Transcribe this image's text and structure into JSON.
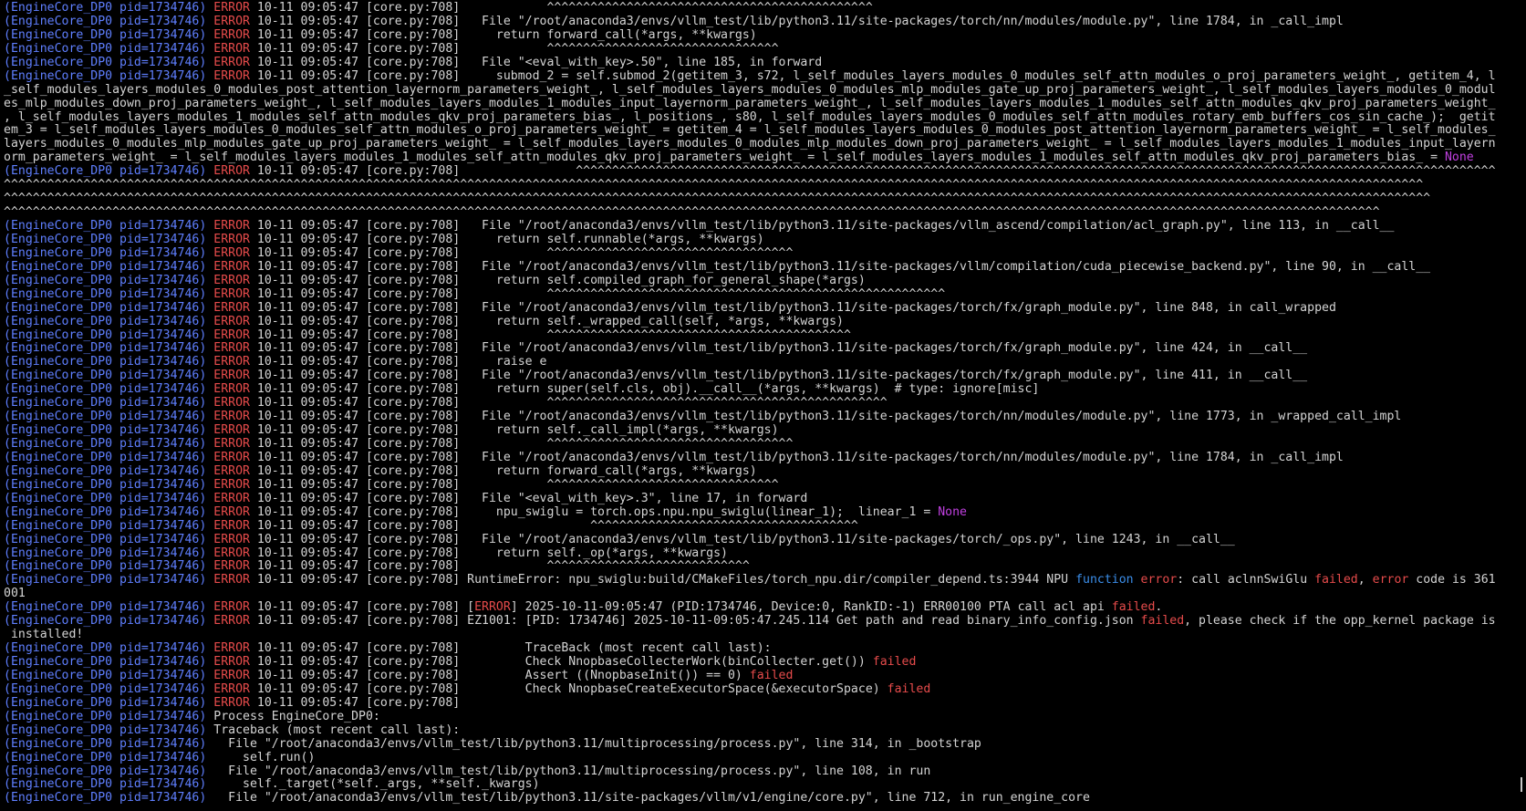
{
  "lines": [
    {
      "seg": [
        {
          "t": "(EngineCore_DP0 pid=1734746) ",
          "c": "proc"
        },
        {
          "t": "ERROR",
          "c": "lvl"
        },
        {
          "t": " 10-11 09:05:47 [core.py:708]            ^^^^^^^^^^^^^^^^^^^^^^^^^^^^^^^^^^^^^^^^^^^^^"
        }
      ]
    },
    {
      "seg": [
        {
          "t": "(EngineCore_DP0 pid=1734746) ",
          "c": "proc"
        },
        {
          "t": "ERROR",
          "c": "lvl"
        },
        {
          "t": " 10-11 09:05:47 [core.py:708]   File \"/root/anaconda3/envs/vllm_test/lib/python3.11/site-packages/torch/nn/modules/module.py\", line 1784, in _call_impl"
        }
      ]
    },
    {
      "seg": [
        {
          "t": "(EngineCore_DP0 pid=1734746) ",
          "c": "proc"
        },
        {
          "t": "ERROR",
          "c": "lvl"
        },
        {
          "t": " 10-11 09:05:47 [core.py:708]     return forward_call(*args, **kwargs)"
        }
      ]
    },
    {
      "seg": [
        {
          "t": "(EngineCore_DP0 pid=1734746) ",
          "c": "proc"
        },
        {
          "t": "ERROR",
          "c": "lvl"
        },
        {
          "t": " 10-11 09:05:47 [core.py:708]            ^^^^^^^^^^^^^^^^^^^^^^^^^^^^^^^^"
        }
      ]
    },
    {
      "seg": [
        {
          "t": "(EngineCore_DP0 pid=1734746) ",
          "c": "proc"
        },
        {
          "t": "ERROR",
          "c": "lvl"
        },
        {
          "t": " 10-11 09:05:47 [core.py:708]   File \"<eval_with_key>.50\", line 185, in forward"
        }
      ]
    },
    {
      "seg": [
        {
          "t": "(EngineCore_DP0 pid=1734746) ",
          "c": "proc"
        },
        {
          "t": "ERROR",
          "c": "lvl"
        },
        {
          "t": " 10-11 09:05:47 [core.py:708]     submod_2 = self.submod_2(getitem_3, s72, l_self_modules_layers_modules_0_modules_self_attn_modules_o_proj_parameters_weight_, getitem_4, l"
        }
      ]
    },
    {
      "seg": [
        {
          "t": "_self_modules_layers_modules_0_modules_post_attention_layernorm_parameters_weight_, l_self_modules_layers_modules_0_modules_mlp_modules_gate_up_proj_parameters_weight_, l_self_modules_layers_modules_0_modul"
        }
      ]
    },
    {
      "seg": [
        {
          "t": "es_mlp_modules_down_proj_parameters_weight_, l_self_modules_layers_modules_1_modules_input_layernorm_parameters_weight_, l_self_modules_layers_modules_1_modules_self_attn_modules_qkv_proj_parameters_weight_"
        }
      ]
    },
    {
      "seg": [
        {
          "t": ", l_self_modules_layers_modules_1_modules_self_attn_modules_qkv_proj_parameters_bias_, l_positions_, s80, l_self_modules_layers_modules_0_modules_self_attn_modules_rotary_emb_buffers_cos_sin_cache_);  getit"
        }
      ]
    },
    {
      "seg": [
        {
          "t": "em_3 = l_self_modules_layers_modules_0_modules_self_attn_modules_o_proj_parameters_weight_ = getitem_4 = l_self_modules_layers_modules_0_modules_post_attention_layernorm_parameters_weight_ = l_self_modules_"
        }
      ]
    },
    {
      "seg": [
        {
          "t": "layers_modules_0_modules_mlp_modules_gate_up_proj_parameters_weight_ = l_self_modules_layers_modules_0_modules_mlp_modules_down_proj_parameters_weight_ = l_self_modules_layers_modules_1_modules_input_layern"
        }
      ]
    },
    {
      "seg": [
        {
          "t": "orm_parameters_weight_ = l_self_modules_layers_modules_1_modules_self_attn_modules_qkv_proj_parameters_weight_ = l_self_modules_layers_modules_1_modules_self_attn_modules_qkv_proj_parameters_bias_ = "
        },
        {
          "t": "None",
          "c": "none"
        }
      ]
    },
    {
      "seg": [
        {
          "t": "(EngineCore_DP0 pid=1734746) ",
          "c": "proc"
        },
        {
          "t": "ERROR",
          "c": "lvl"
        },
        {
          "t": " 10-11 09:05:47 [core.py:708]                ^^^^^^^^^^^^^^^^^^^^^^^^^^^^^^^^^^^^^^^^^^^^^^^^^^^^^^^^^^^^^^^^^^^^^^^^^^^^^^^^^^^^^^^^^^^^^^^^^^^^^^^^^^^^^^^^^^^^^^^^^^^^^^^"
        }
      ]
    },
    {
      "seg": [
        {
          "t": "^^^^^^^^^^^^^^^^^^^^^^^^^^^^^^^^^^^^^^^^^^^^^^^^^^^^^^^^^^^^^^^^^^^^^^^^^^^^^^^^^^^^^^^^^^^^^^^^^^^^^^^^^^^^^^^^^^^^^^^^^^^^^^^^^^^^^^^^^^^^^^^^^^^^^^^^^^^^^^^^^^^^^^^^^^^^^^^^^^^^^^^^^^^^^^^^^^^^"
        }
      ]
    },
    {
      "seg": [
        {
          "t": "^^^^^^^^^^^^^^^^^^^^^^^^^^^^^^^^^^^^^^^^^^^^^^^^^^^^^^^^^^^^^^^^^^^^^^^^^^^^^^^^^^^^^^^^^^^^^^^^^^^^^^^^^^^^^^^^^^^^^^^^^^^^^^^^^^^^^^^^^^^^^^^^^^^^^^^^^^^^^^^^^^^^^^^^^^^^^^^^^^^^^^^^^^^^^^^^^^^^^"
        }
      ]
    },
    {
      "seg": [
        {
          "t": "^^^^^^^^^^^^^^^^^^^^^^^^^^^^^^^^^^^^^^^^^^^^^^^^^^^^^^^^^^^^^^^^^^^^^^^^^^^^^^^^^^^^^^^^^^^^^^^^^^^^^^^^^^^^^^^^^^^^^^^^^^^^^^^^^^^^^^^^^^^^^^^^^^^^^^^^^^^^^^^^^^^^^^^^^^^^^^^^^^^^^^^^^^^^^^"
        }
      ]
    },
    {
      "seg": [
        {
          "t": "(EngineCore_DP0 pid=1734746) ",
          "c": "proc"
        },
        {
          "t": "ERROR",
          "c": "lvl"
        },
        {
          "t": " 10-11 09:05:47 [core.py:708]   File \"/root/anaconda3/envs/vllm_test/lib/python3.11/site-packages/vllm_ascend/compilation/acl_graph.py\", line 113, in __call__"
        }
      ]
    },
    {
      "seg": [
        {
          "t": "(EngineCore_DP0 pid=1734746) ",
          "c": "proc"
        },
        {
          "t": "ERROR",
          "c": "lvl"
        },
        {
          "t": " 10-11 09:05:47 [core.py:708]     return self.runnable(*args, **kwargs)"
        }
      ]
    },
    {
      "seg": [
        {
          "t": "(EngineCore_DP0 pid=1734746) ",
          "c": "proc"
        },
        {
          "t": "ERROR",
          "c": "lvl"
        },
        {
          "t": " 10-11 09:05:47 [core.py:708]            ^^^^^^^^^^^^^^^^^^^^^^^^^^^^^^^^^^"
        }
      ]
    },
    {
      "seg": [
        {
          "t": "(EngineCore_DP0 pid=1734746) ",
          "c": "proc"
        },
        {
          "t": "ERROR",
          "c": "lvl"
        },
        {
          "t": " 10-11 09:05:47 [core.py:708]   File \"/root/anaconda3/envs/vllm_test/lib/python3.11/site-packages/vllm/compilation/cuda_piecewise_backend.py\", line 90, in __call__"
        }
      ]
    },
    {
      "seg": [
        {
          "t": "(EngineCore_DP0 pid=1734746) ",
          "c": "proc"
        },
        {
          "t": "ERROR",
          "c": "lvl"
        },
        {
          "t": " 10-11 09:05:47 [core.py:708]     return self.compiled_graph_for_general_shape(*args)"
        }
      ]
    },
    {
      "seg": [
        {
          "t": "(EngineCore_DP0 pid=1734746) ",
          "c": "proc"
        },
        {
          "t": "ERROR",
          "c": "lvl"
        },
        {
          "t": " 10-11 09:05:47 [core.py:708]            ^^^^^^^^^^^^^^^^^^^^^^^^^^^^^^^^^^^^^^^^^^^^^^^^^^^^^^^"
        }
      ]
    },
    {
      "seg": [
        {
          "t": "(EngineCore_DP0 pid=1734746) ",
          "c": "proc"
        },
        {
          "t": "ERROR",
          "c": "lvl"
        },
        {
          "t": " 10-11 09:05:47 [core.py:708]   File \"/root/anaconda3/envs/vllm_test/lib/python3.11/site-packages/torch/fx/graph_module.py\", line 848, in call_wrapped"
        }
      ]
    },
    {
      "seg": [
        {
          "t": "(EngineCore_DP0 pid=1734746) ",
          "c": "proc"
        },
        {
          "t": "ERROR",
          "c": "lvl"
        },
        {
          "t": " 10-11 09:05:47 [core.py:708]     return self._wrapped_call(self, *args, **kwargs)"
        }
      ]
    },
    {
      "seg": [
        {
          "t": "(EngineCore_DP0 pid=1734746) ",
          "c": "proc"
        },
        {
          "t": "ERROR",
          "c": "lvl"
        },
        {
          "t": " 10-11 09:05:47 [core.py:708]            ^^^^^^^^^^^^^^^^^^^^^^^^^^^^^^^^^^^^^^^^^^"
        }
      ]
    },
    {
      "seg": [
        {
          "t": "(EngineCore_DP0 pid=1734746) ",
          "c": "proc"
        },
        {
          "t": "ERROR",
          "c": "lvl"
        },
        {
          "t": " 10-11 09:05:47 [core.py:708]   File \"/root/anaconda3/envs/vllm_test/lib/python3.11/site-packages/torch/fx/graph_module.py\", line 424, in __call__"
        }
      ]
    },
    {
      "seg": [
        {
          "t": "(EngineCore_DP0 pid=1734746) ",
          "c": "proc"
        },
        {
          "t": "ERROR",
          "c": "lvl"
        },
        {
          "t": " 10-11 09:05:47 [core.py:708]     raise e"
        }
      ]
    },
    {
      "seg": [
        {
          "t": "(EngineCore_DP0 pid=1734746) ",
          "c": "proc"
        },
        {
          "t": "ERROR",
          "c": "lvl"
        },
        {
          "t": " 10-11 09:05:47 [core.py:708]   File \"/root/anaconda3/envs/vllm_test/lib/python3.11/site-packages/torch/fx/graph_module.py\", line 411, in __call__"
        }
      ]
    },
    {
      "seg": [
        {
          "t": "(EngineCore_DP0 pid=1734746) ",
          "c": "proc"
        },
        {
          "t": "ERROR",
          "c": "lvl"
        },
        {
          "t": " 10-11 09:05:47 [core.py:708]     return super(self.cls, obj).__call__(*args, **kwargs)  # type: ignore[misc]"
        }
      ]
    },
    {
      "seg": [
        {
          "t": "(EngineCore_DP0 pid=1734746) ",
          "c": "proc"
        },
        {
          "t": "ERROR",
          "c": "lvl"
        },
        {
          "t": " 10-11 09:05:47 [core.py:708]            ^^^^^^^^^^^^^^^^^^^^^^^^^^^^^^^^^^^^^^^^^^^^^^^"
        }
      ]
    },
    {
      "seg": [
        {
          "t": "(EngineCore_DP0 pid=1734746) ",
          "c": "proc"
        },
        {
          "t": "ERROR",
          "c": "lvl"
        },
        {
          "t": " 10-11 09:05:47 [core.py:708]   File \"/root/anaconda3/envs/vllm_test/lib/python3.11/site-packages/torch/nn/modules/module.py\", line 1773, in _wrapped_call_impl"
        }
      ]
    },
    {
      "seg": [
        {
          "t": "(EngineCore_DP0 pid=1734746) ",
          "c": "proc"
        },
        {
          "t": "ERROR",
          "c": "lvl"
        },
        {
          "t": " 10-11 09:05:47 [core.py:708]     return self._call_impl(*args, **kwargs)"
        }
      ]
    },
    {
      "seg": [
        {
          "t": "(EngineCore_DP0 pid=1734746) ",
          "c": "proc"
        },
        {
          "t": "ERROR",
          "c": "lvl"
        },
        {
          "t": " 10-11 09:05:47 [core.py:708]            ^^^^^^^^^^^^^^^^^^^^^^^^^^^^^^^^^^"
        }
      ]
    },
    {
      "seg": [
        {
          "t": "(EngineCore_DP0 pid=1734746) ",
          "c": "proc"
        },
        {
          "t": "ERROR",
          "c": "lvl"
        },
        {
          "t": " 10-11 09:05:47 [core.py:708]   File \"/root/anaconda3/envs/vllm_test/lib/python3.11/site-packages/torch/nn/modules/module.py\", line 1784, in _call_impl"
        }
      ]
    },
    {
      "seg": [
        {
          "t": "(EngineCore_DP0 pid=1734746) ",
          "c": "proc"
        },
        {
          "t": "ERROR",
          "c": "lvl"
        },
        {
          "t": " 10-11 09:05:47 [core.py:708]     return forward_call(*args, **kwargs)"
        }
      ]
    },
    {
      "seg": [
        {
          "t": "(EngineCore_DP0 pid=1734746) ",
          "c": "proc"
        },
        {
          "t": "ERROR",
          "c": "lvl"
        },
        {
          "t": " 10-11 09:05:47 [core.py:708]            ^^^^^^^^^^^^^^^^^^^^^^^^^^^^^^^^"
        }
      ]
    },
    {
      "seg": [
        {
          "t": "(EngineCore_DP0 pid=1734746) ",
          "c": "proc"
        },
        {
          "t": "ERROR",
          "c": "lvl"
        },
        {
          "t": " 10-11 09:05:47 [core.py:708]   File \"<eval_with_key>.3\", line 17, in forward"
        }
      ]
    },
    {
      "seg": [
        {
          "t": "(EngineCore_DP0 pid=1734746) ",
          "c": "proc"
        },
        {
          "t": "ERROR",
          "c": "lvl"
        },
        {
          "t": " 10-11 09:05:47 [core.py:708]     npu_swiglu = torch.ops.npu.npu_swiglu(linear_1);  linear_1 = "
        },
        {
          "t": "None",
          "c": "none"
        }
      ]
    },
    {
      "seg": [
        {
          "t": "(EngineCore_DP0 pid=1734746) ",
          "c": "proc"
        },
        {
          "t": "ERROR",
          "c": "lvl"
        },
        {
          "t": " 10-11 09:05:47 [core.py:708]                  ^^^^^^^^^^^^^^^^^^^^^^^^^^^^^^^^^^^^^"
        }
      ]
    },
    {
      "seg": [
        {
          "t": "(EngineCore_DP0 pid=1734746) ",
          "c": "proc"
        },
        {
          "t": "ERROR",
          "c": "lvl"
        },
        {
          "t": " 10-11 09:05:47 [core.py:708]   File \"/root/anaconda3/envs/vllm_test/lib/python3.11/site-packages/torch/_ops.py\", line 1243, in __call__"
        }
      ]
    },
    {
      "seg": [
        {
          "t": "(EngineCore_DP0 pid=1734746) ",
          "c": "proc"
        },
        {
          "t": "ERROR",
          "c": "lvl"
        },
        {
          "t": " 10-11 09:05:47 [core.py:708]     return self._op(*args, **kwargs)"
        }
      ]
    },
    {
      "seg": [
        {
          "t": "(EngineCore_DP0 pid=1734746) ",
          "c": "proc"
        },
        {
          "t": "ERROR",
          "c": "lvl"
        },
        {
          "t": " 10-11 09:05:47 [core.py:708]            ^^^^^^^^^^^^^^^^^^^^^^^^^^^^"
        }
      ]
    },
    {
      "seg": [
        {
          "t": "(EngineCore_DP0 pid=1734746) ",
          "c": "proc"
        },
        {
          "t": "ERROR",
          "c": "lvl"
        },
        {
          "t": " 10-11 09:05:47 [core.py:708] RuntimeError: npu_swiglu:build/CMakeFiles/torch_npu.dir/compiler_depend.ts:3944 NPU "
        },
        {
          "t": "function",
          "c": "kw"
        },
        {
          "t": " "
        },
        {
          "t": "error",
          "c": "fail"
        },
        {
          "t": ": call aclnnSwiGlu "
        },
        {
          "t": "failed",
          "c": "fail"
        },
        {
          "t": ", "
        },
        {
          "t": "error",
          "c": "fail"
        },
        {
          "t": " code is 361"
        }
      ]
    },
    {
      "seg": [
        {
          "t": "001"
        }
      ]
    },
    {
      "seg": [
        {
          "t": "(EngineCore_DP0 pid=1734746) ",
          "c": "proc"
        },
        {
          "t": "ERROR",
          "c": "lvl"
        },
        {
          "t": " 10-11 09:05:47 [core.py:708] ["
        },
        {
          "t": "ERROR",
          "c": "fail"
        },
        {
          "t": "] 2025-10-11-09:05:47 (PID:1734746, Device:0, RankID:-1) ERR00100 PTA call acl api "
        },
        {
          "t": "failed",
          "c": "fail"
        },
        {
          "t": "."
        }
      ]
    },
    {
      "seg": [
        {
          "t": "(EngineCore_DP0 pid=1734746) ",
          "c": "proc"
        },
        {
          "t": "ERROR",
          "c": "lvl"
        },
        {
          "t": " 10-11 09:05:47 [core.py:708] EZ1001: [PID: 1734746] 2025-10-11-09:05:47.245.114 Get path and read binary_info_config.json "
        },
        {
          "t": "failed",
          "c": "fail"
        },
        {
          "t": ", please check if the opp_kernel package is"
        }
      ]
    },
    {
      "seg": [
        {
          "t": " installed!"
        }
      ]
    },
    {
      "seg": [
        {
          "t": "(EngineCore_DP0 pid=1734746) ",
          "c": "proc"
        },
        {
          "t": "ERROR",
          "c": "lvl"
        },
        {
          "t": " 10-11 09:05:47 [core.py:708]         TraceBack (most recent call last):"
        }
      ]
    },
    {
      "seg": [
        {
          "t": "(EngineCore_DP0 pid=1734746) ",
          "c": "proc"
        },
        {
          "t": "ERROR",
          "c": "lvl"
        },
        {
          "t": " 10-11 09:05:47 [core.py:708]         Check NnopbaseCollecterWork(binCollecter.get()) "
        },
        {
          "t": "failed",
          "c": "fail"
        }
      ]
    },
    {
      "seg": [
        {
          "t": "(EngineCore_DP0 pid=1734746) ",
          "c": "proc"
        },
        {
          "t": "ERROR",
          "c": "lvl"
        },
        {
          "t": " 10-11 09:05:47 [core.py:708]         Assert ((NnopbaseInit()) == 0) "
        },
        {
          "t": "failed",
          "c": "fail"
        }
      ]
    },
    {
      "seg": [
        {
          "t": "(EngineCore_DP0 pid=1734746) ",
          "c": "proc"
        },
        {
          "t": "ERROR",
          "c": "lvl"
        },
        {
          "t": " 10-11 09:05:47 [core.py:708]         Check NnopbaseCreateExecutorSpace(&executorSpace) "
        },
        {
          "t": "failed",
          "c": "fail"
        }
      ]
    },
    {
      "seg": [
        {
          "t": "(EngineCore_DP0 pid=1734746) ",
          "c": "proc"
        },
        {
          "t": "ERROR",
          "c": "lvl"
        },
        {
          "t": " 10-11 09:05:47 [core.py:708]"
        }
      ]
    },
    {
      "seg": [
        {
          "t": "(EngineCore_DP0 pid=1734746) ",
          "c": "proc"
        },
        {
          "t": "Process EngineCore_DP0:"
        }
      ]
    },
    {
      "seg": [
        {
          "t": "(EngineCore_DP0 pid=1734746) ",
          "c": "proc"
        },
        {
          "t": "Traceback (most recent call last):"
        }
      ]
    },
    {
      "seg": [
        {
          "t": "(EngineCore_DP0 pid=1734746) ",
          "c": "proc"
        },
        {
          "t": "  File \"/root/anaconda3/envs/vllm_test/lib/python3.11/multiprocessing/process.py\", line 314, in _bootstrap"
        }
      ]
    },
    {
      "seg": [
        {
          "t": "(EngineCore_DP0 pid=1734746) ",
          "c": "proc"
        },
        {
          "t": "    self.run()"
        }
      ]
    },
    {
      "seg": [
        {
          "t": "(EngineCore_DP0 pid=1734746) ",
          "c": "proc"
        },
        {
          "t": "  File \"/root/anaconda3/envs/vllm_test/lib/python3.11/multiprocessing/process.py\", line 108, in run"
        }
      ]
    },
    {
      "seg": [
        {
          "t": "(EngineCore_DP0 pid=1734746) ",
          "c": "proc"
        },
        {
          "t": "    self._target(*self._args, **self._kwargs)"
        }
      ]
    },
    {
      "seg": [
        {
          "t": "(EngineCore_DP0 pid=1734746) ",
          "c": "proc"
        },
        {
          "t": "  File \"/root/anaconda3/envs/vllm_test/lib/python3.11/site-packages/vllm/v1/engine/core.py\", line 712, in run_engine_core"
        }
      ]
    }
  ]
}
